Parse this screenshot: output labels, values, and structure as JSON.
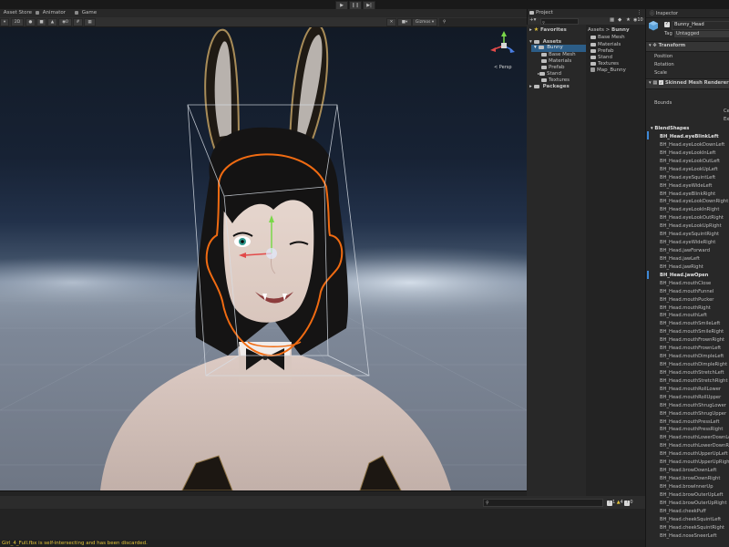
{
  "toolbar": {
    "play_icon": "play-icon",
    "pause_icon": "pause-icon",
    "step_icon": "step-icon"
  },
  "scene": {
    "tabs": [
      {
        "label": "Asset Store",
        "icon": "asset-store-icon"
      },
      {
        "label": "Animator",
        "icon": "animator-icon"
      },
      {
        "label": "Game",
        "icon": "game-icon"
      }
    ],
    "mode_2d": "2D",
    "gizmos": "Gizmos",
    "search_placeholder": "All",
    "persp": "< Persp"
  },
  "project": {
    "tab": "Project",
    "favorites": "Favorites",
    "tree": {
      "assets": "Assets",
      "bunny": "Bunny",
      "children": [
        "Base Mesh",
        "Materials",
        "Prefab",
        "Stand",
        "Textures"
      ],
      "packages": "Packages"
    },
    "breadcrumb": {
      "root": "Assets",
      "sep": ">",
      "current": "Bunny"
    },
    "items": [
      "Base Mesh",
      "Materials",
      "Prefab",
      "Stand",
      "Textures",
      "Map_Bunny"
    ],
    "badge": "10"
  },
  "inspector": {
    "tab": "Inspector",
    "object_name": "Bunny_Head",
    "tag_label": "Tag",
    "tag_value": "Untagged",
    "transform": {
      "title": "Transform",
      "fields": [
        "Position",
        "Rotation",
        "Scale"
      ]
    },
    "smr": {
      "title": "Skinned Mesh Renderer",
      "bounds": "Bounds",
      "bounds_right": [
        "Ce",
        "Ex"
      ]
    },
    "blendshapes_label": "BlendShapes",
    "blendshapes": [
      "BH_Head.eyeBlinkLeft",
      "BH_Head.eyeLookDownLeft",
      "BH_Head.eyeLookInLeft",
      "BH_Head.eyeLookOutLeft",
      "BH_Head.eyeLookUpLeft",
      "BH_Head.eyeSquintLeft",
      "BH_Head.eyeWideLeft",
      "BH_Head.eyeBlinkRight",
      "BH_Head.eyeLookDownRight",
      "BH_Head.eyeLookInRight",
      "BH_Head.eyeLookOutRight",
      "BH_Head.eyeLookUpRight",
      "BH_Head.eyeSquintRight",
      "BH_Head.eyeWideRight",
      "BH_Head.jawForward",
      "BH_Head.jawLeft",
      "BH_Head.jawRight",
      "BH_Head.jawOpen",
      "BH_Head.mouthClose",
      "BH_Head.mouthFunnel",
      "BH_Head.mouthPucker",
      "BH_Head.mouthRight",
      "BH_Head.mouthLeft",
      "BH_Head.mouthSmileLeft",
      "BH_Head.mouthSmileRight",
      "BH_Head.mouthFrownRight",
      "BH_Head.mouthFrownLeft",
      "BH_Head.mouthDimpleLeft",
      "BH_Head.mouthDimpleRight",
      "BH_Head.mouthStretchLeft",
      "BH_Head.mouthStretchRight",
      "BH_Head.mouthRollLower",
      "BH_Head.mouthRollUpper",
      "BH_Head.mouthShrugLower",
      "BH_Head.mouthShrugUpper",
      "BH_Head.mouthPressLeft",
      "BH_Head.mouthPressRight",
      "BH_Head.mouthLowerDownLeft",
      "BH_Head.mouthLowerDownRight",
      "BH_Head.mouthUpperUpLeft",
      "BH_Head.mouthUpperUpRight",
      "BH_Head.browDownLeft",
      "BH_Head.browDownRight",
      "BH_Head.browInnerUp",
      "BH_Head.browOuterUpLeft",
      "BH_Head.browOuterUpRight",
      "BH_Head.cheekPuff",
      "BH_Head.cheekSquintLeft",
      "BH_Head.cheekSquintRight",
      "BH_Head.noseSneerLeft"
    ],
    "bold_items": [
      "BH_Head.eyeBlinkLeft",
      "BH_Head.jawOpen"
    ]
  },
  "console": {
    "counts": {
      "info": "1",
      "warn": "4",
      "error": "0"
    },
    "status_message": "Girl_4_Full.fbx is self-intersecting and has been discarded."
  },
  "colors": {
    "selection_outline": "#f06b12",
    "accent_blue": "#2c5d87",
    "warning": "#e3c33b"
  }
}
